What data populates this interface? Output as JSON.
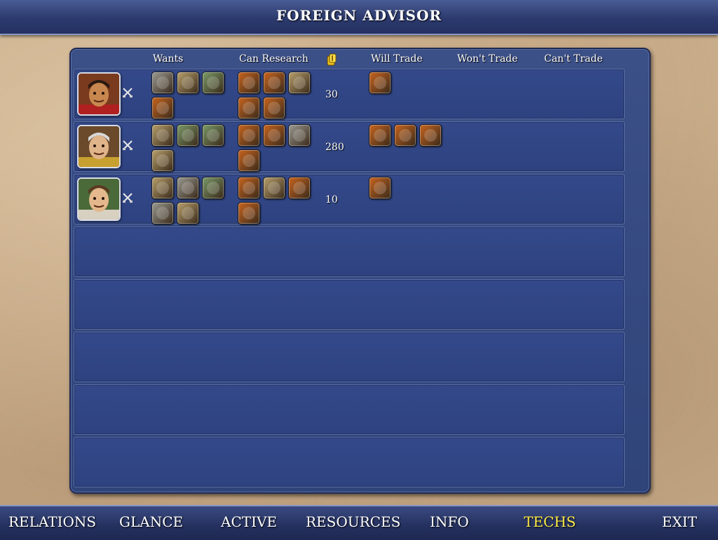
{
  "window": {
    "title": "FOREIGN ADVISOR"
  },
  "table": {
    "headers": {
      "wants": "Wants",
      "can_research": "Can Research",
      "gold_icon": "gold-coins-icon",
      "will_trade": "Will Trade",
      "wont_trade": "Won't Trade",
      "cant_trade": "Can't Trade"
    },
    "rows": [
      {
        "leader": "chinese-leader-portrait",
        "at_war": true,
        "wants": [
          "gray-tech",
          "tan-tech",
          "green-tech",
          "orange-tech"
        ],
        "can_research": [
          "orange-tech",
          "orange-tech",
          "tan-tech",
          "orange-tech",
          "orange-tech"
        ],
        "gold": "30",
        "will_trade": [
          "orange-tech"
        ],
        "wont_trade": [],
        "cant_trade": []
      },
      {
        "leader": "german-leader-portrait",
        "at_war": true,
        "wants": [
          "tan-tech",
          "green-tech",
          "green-tech",
          "tan-tech"
        ],
        "can_research": [
          "orange-tech",
          "orange-tech",
          "gray-tech",
          "orange-tech"
        ],
        "gold": "280",
        "will_trade": [
          "orange-tech",
          "orange-tech",
          "orange-tech"
        ],
        "wont_trade": [],
        "cant_trade": []
      },
      {
        "leader": "roman-leader-portrait",
        "at_war": true,
        "wants": [
          "tan-tech",
          "gray-tech",
          "green-tech",
          "gray-tech",
          "tan-tech"
        ],
        "can_research": [
          "orange-tech",
          "tan-tech",
          "orange-tech",
          "orange-tech"
        ],
        "gold": "10",
        "will_trade": [
          "orange-tech"
        ],
        "wont_trade": [],
        "cant_trade": []
      }
    ],
    "empty_rows": 5
  },
  "colors": {
    "orange-tech": "#c8641e",
    "tan-tech": "#b8a06c",
    "gray-tech": "#9a9a92",
    "green-tech": "#7a9a68",
    "active_tab": "#ffec4a"
  },
  "nav": {
    "items": [
      {
        "label": "RELATIONS",
        "active": false
      },
      {
        "label": "GLANCE",
        "active": false
      },
      {
        "label": "ACTIVE",
        "active": false
      },
      {
        "label": "RESOURCES",
        "active": false
      },
      {
        "label": "INFO",
        "active": false
      },
      {
        "label": "TECHS",
        "active": true
      },
      {
        "label": "EXIT",
        "active": false
      }
    ]
  }
}
